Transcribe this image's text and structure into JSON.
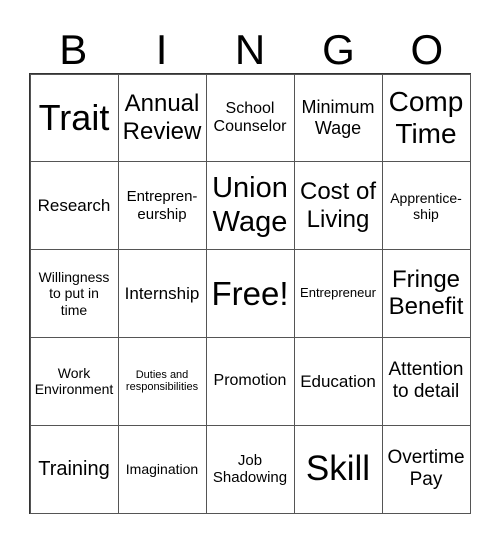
{
  "header": [
    "B",
    "I",
    "N",
    "G",
    "O"
  ],
  "cells": [
    "Trait",
    "Annual\nReview",
    "School\nCounselor",
    "Minimum\nWage",
    "Comp\nTime",
    "Research",
    "Entrepren-\neurship",
    "Union\nWage",
    "Cost of\nLiving",
    "Apprentice-\nship",
    "Willingness\nto put in\ntime",
    "Internship",
    "Free!",
    "Entrepreneur",
    "Fringe\nBenefit",
    "Work\nEnvironment",
    "Duties and\nresponsibilities",
    "Promotion",
    "Education",
    "Attention\nto detail",
    "Training",
    "Imagination",
    "Job\nShadowing",
    "Skill",
    "Overtime\nPay"
  ]
}
